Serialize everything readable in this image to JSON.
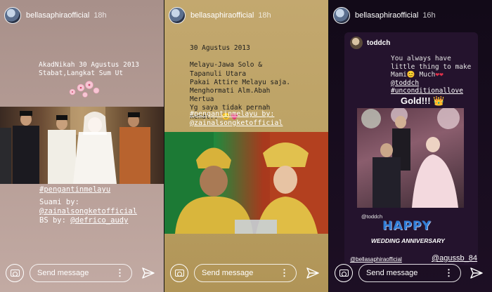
{
  "stories": [
    {
      "username": "bellasaphiraofficial",
      "time": "18h",
      "caption": "AkadNikah 30 Agustus 2013\nStabat,Langkat Sum Ut",
      "hashtag": "#pengantinmelayu",
      "credit_label1": "Suami by:",
      "credit_tag1": "@zainalsongketofficial",
      "credit_label2": "BS by:",
      "credit_tag2": "@defrico_audy",
      "message_placeholder": "Send message"
    },
    {
      "username": "bellasaphiraofficial",
      "time": "18h",
      "caption": "30 Agustus 2013\n\nMelayu-Jawa Solo &\nTapanuli Utara\nPakai Attire Melayu saja.\nMenghormati Alm.Abah\nMertua\nYg saya tidak pernah\nkenal..",
      "hashtag": "#pengantinmelayu by:",
      "credit_tag": "@zainalsongketofficial",
      "message_placeholder": "Send message"
    },
    {
      "username": "bellasaphiraofficial",
      "time": "16h",
      "shared_user": "toddch",
      "shared_message": "You always have little thing to make Mami",
      "shared_message_tail": "Much",
      "shared_tag1": "@toddch",
      "shared_tag2": "#unconditionallove",
      "gold_text": "Gold!!!",
      "photo_credit": "@toddch",
      "happy_text": "HAPPY",
      "anniversary_text": "WEDDING ANNIVERSARY",
      "mention_left": "@bellasaphiraofficial",
      "mention_right": "@agussb_84",
      "message_placeholder": "Send message"
    }
  ],
  "icons": {
    "camera": "camera-icon",
    "more": "more-dots-icon",
    "send": "send-icon"
  }
}
